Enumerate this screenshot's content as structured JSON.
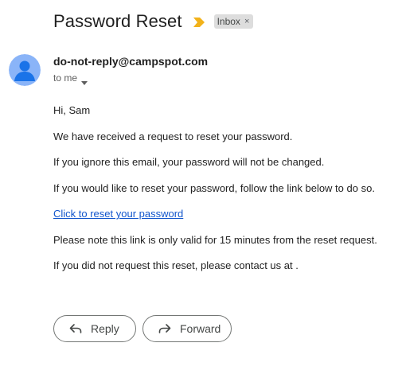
{
  "email": {
    "subject": "Password Reset",
    "label": "Inbox",
    "label_remove": "×",
    "sender": "do-not-reply@campspot.com",
    "recipient": "to me",
    "body": {
      "greeting": "Hi, Sam",
      "line1": "We have received a request to reset your password.",
      "line2": "If you ignore this email, your password will not be changed.",
      "line3": "If you would like to reset your password, follow the link below to do so.",
      "link_text": "Click to reset your password",
      "line4": "Please note this link is only valid for 15 minutes from the reset request.",
      "line5": "If you did not request this reset, please contact us at ."
    }
  },
  "actions": {
    "reply_label": "Reply",
    "forward_label": "Forward"
  },
  "icons": {
    "important": "important-marker-icon",
    "avatar": "default-avatar-icon",
    "caret": "caret-down-icon",
    "reply": "reply-arrow-icon",
    "forward": "forward-arrow-icon"
  },
  "colors": {
    "important_marker": "#f2b21a",
    "avatar_bg": "#8ab4f8",
    "avatar_fg": "#1a73e8",
    "link": "#1155cc",
    "label_chip_bg": "#dddddd"
  }
}
